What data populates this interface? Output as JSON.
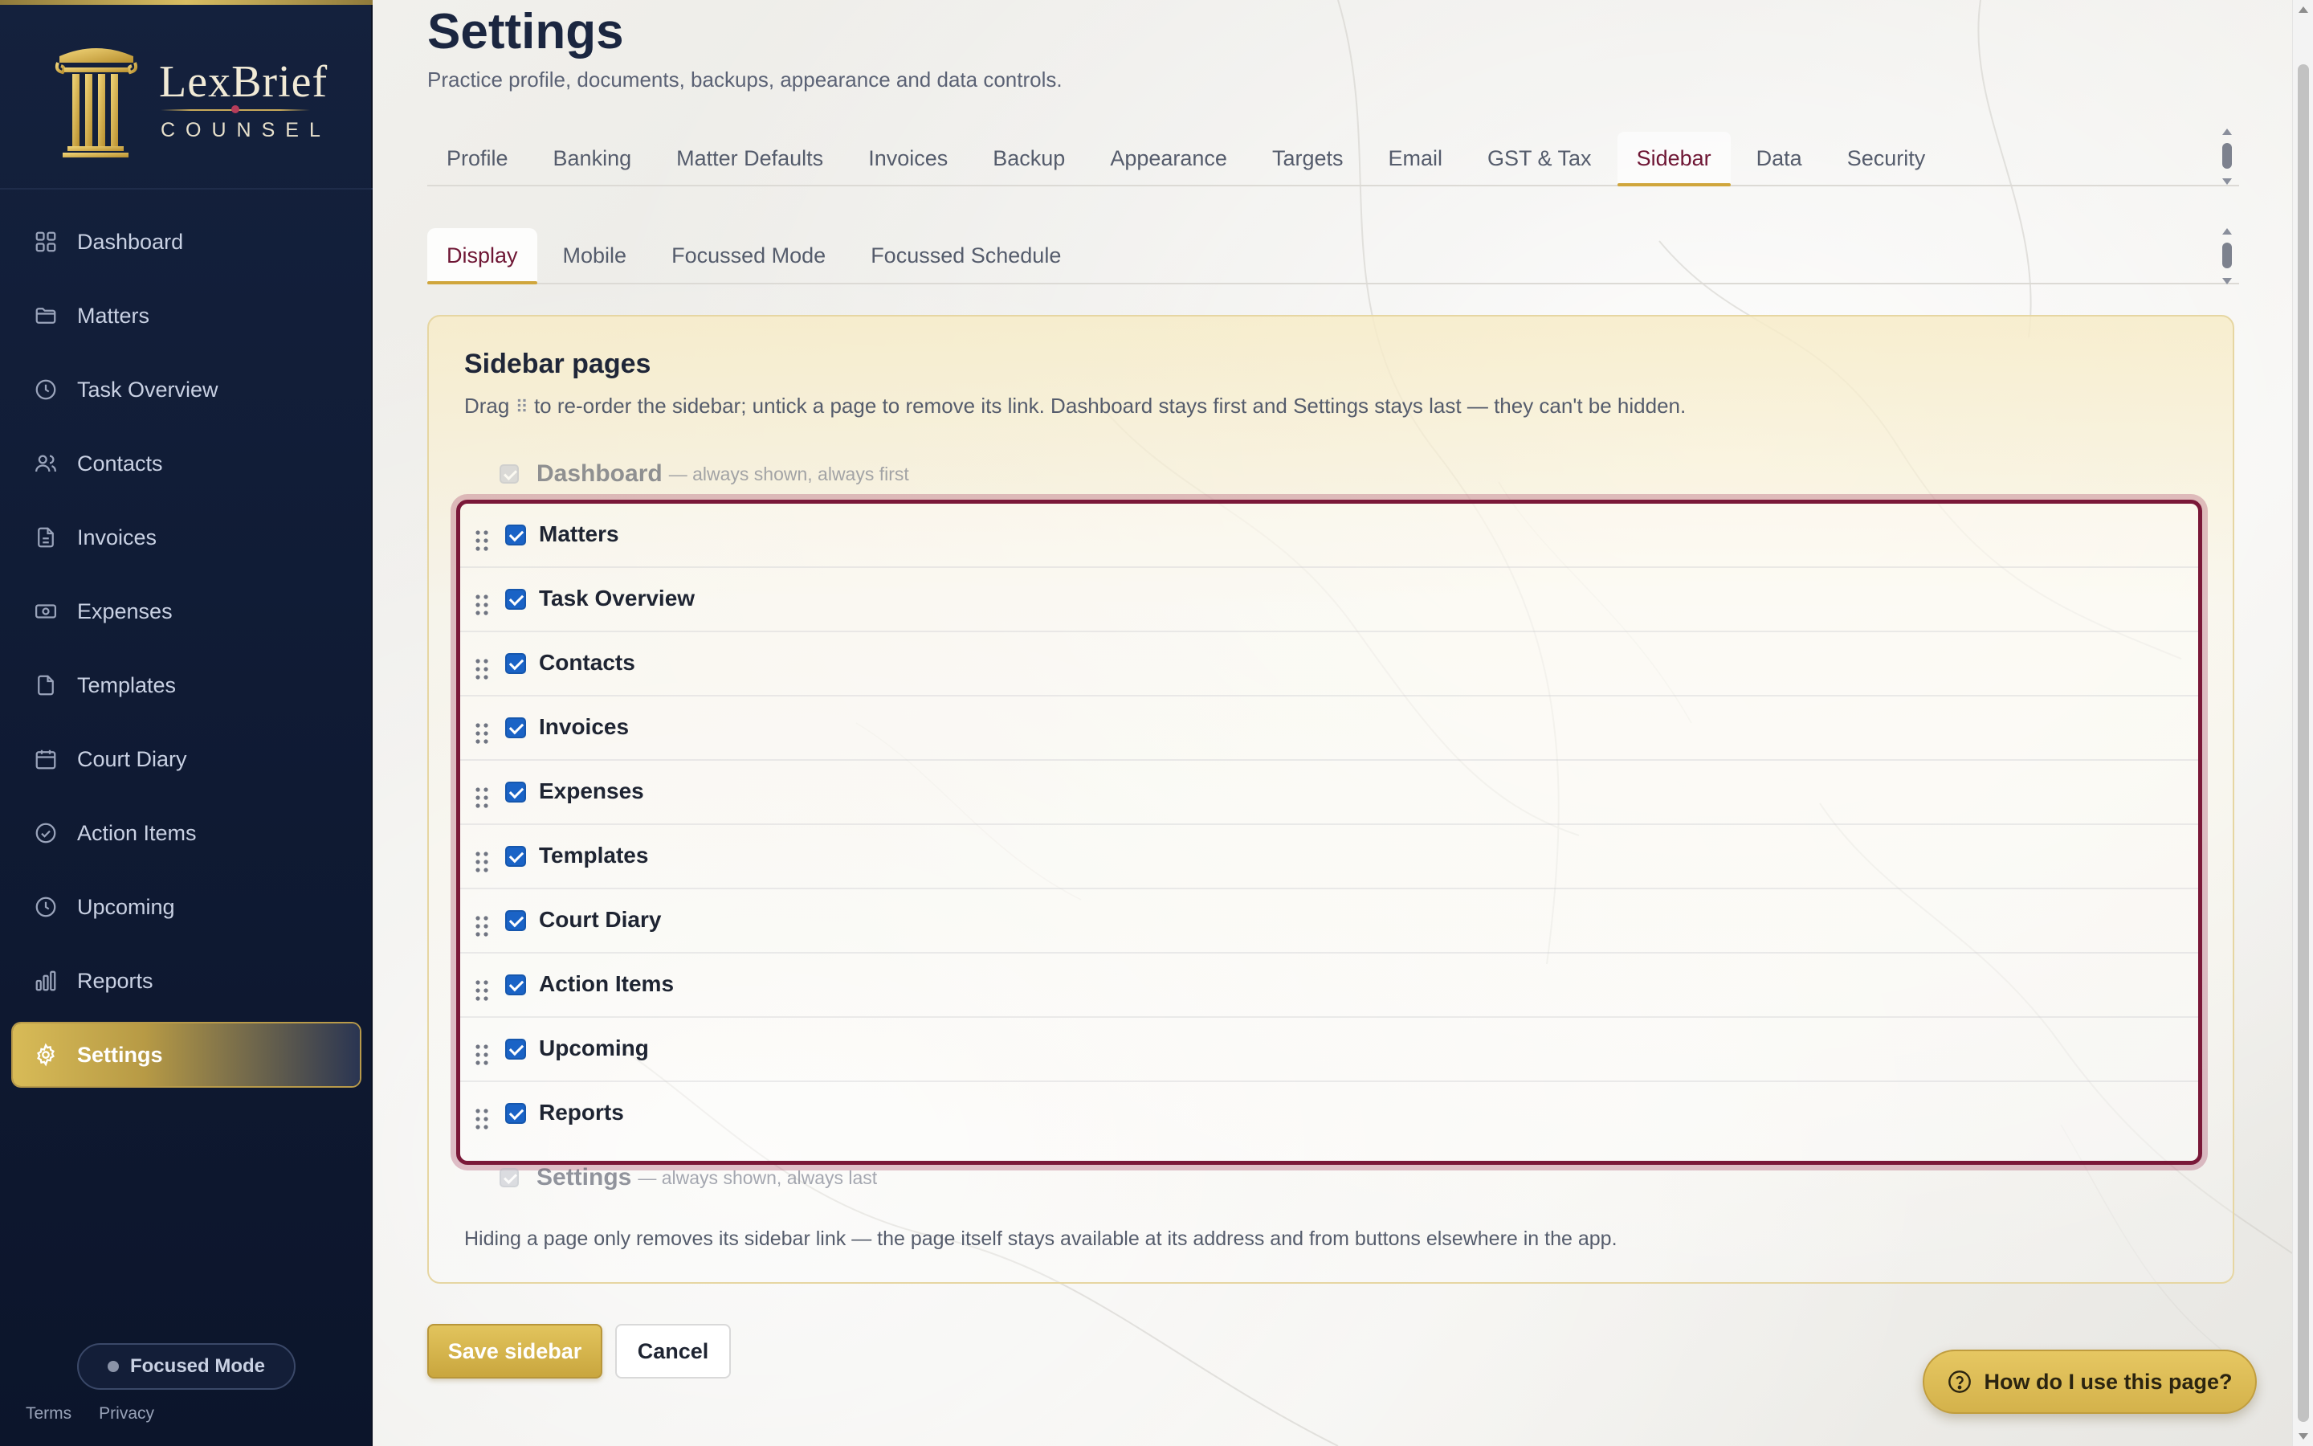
{
  "brand": {
    "name": "LexBrief",
    "subtitle": "COUNSEL",
    "colors": {
      "navy": "#14213d",
      "gold": "#d8bd62",
      "crimson": "#7a1838"
    }
  },
  "sidebar": {
    "items": [
      {
        "label": "Dashboard",
        "icon": "grid-icon"
      },
      {
        "label": "Matters",
        "icon": "folder-icon"
      },
      {
        "label": "Task Overview",
        "icon": "clock-icon"
      },
      {
        "label": "Contacts",
        "icon": "users-icon"
      },
      {
        "label": "Invoices",
        "icon": "document-icon"
      },
      {
        "label": "Expenses",
        "icon": "banknote-icon"
      },
      {
        "label": "Templates",
        "icon": "file-icon"
      },
      {
        "label": "Court Diary",
        "icon": "calendar-icon"
      },
      {
        "label": "Action Items",
        "icon": "check-circle-icon"
      },
      {
        "label": "Upcoming",
        "icon": "clock-icon"
      },
      {
        "label": "Reports",
        "icon": "bar-chart-icon"
      },
      {
        "label": "Settings",
        "icon": "gear-icon",
        "active": true
      }
    ],
    "focused_mode_label": "Focused Mode",
    "footer": {
      "terms": "Terms",
      "privacy": "Privacy"
    }
  },
  "page": {
    "title": "Settings",
    "subtitle": "Practice profile, documents, backups, appearance and data controls."
  },
  "tabs": {
    "items": [
      "Profile",
      "Banking",
      "Matter Defaults",
      "Invoices",
      "Backup",
      "Appearance",
      "Targets",
      "Email",
      "GST & Tax",
      "Sidebar",
      "Data",
      "Security"
    ],
    "active": "Sidebar"
  },
  "subtabs": {
    "items": [
      "Display",
      "Mobile",
      "Focussed Mode",
      "Focussed Schedule"
    ],
    "active": "Display"
  },
  "card": {
    "title": "Sidebar pages",
    "desc_prefix": "Drag",
    "desc_grip": "⠿",
    "desc_suffix": "to re-order the sidebar; untick a page to remove its link. Dashboard stays first and Settings stays last — they can't be hidden.",
    "first": {
      "name": "Dashboard",
      "note": "— always shown, always first"
    },
    "last": {
      "name": "Settings",
      "note": "— always shown, always last"
    },
    "pages": [
      {
        "label": "Matters",
        "checked": true
      },
      {
        "label": "Task Overview",
        "checked": true
      },
      {
        "label": "Contacts",
        "checked": true
      },
      {
        "label": "Invoices",
        "checked": true
      },
      {
        "label": "Expenses",
        "checked": true
      },
      {
        "label": "Templates",
        "checked": true
      },
      {
        "label": "Court Diary",
        "checked": true
      },
      {
        "label": "Action Items",
        "checked": true
      },
      {
        "label": "Upcoming",
        "checked": true
      },
      {
        "label": "Reports",
        "checked": true
      }
    ],
    "footnote": "Hiding a page only removes its sidebar link — the page itself stays available at its address and from buttons elsewhere in the app."
  },
  "actions": {
    "save_label": "Save sidebar",
    "cancel_label": "Cancel",
    "help_label": "How do I use this page?"
  }
}
